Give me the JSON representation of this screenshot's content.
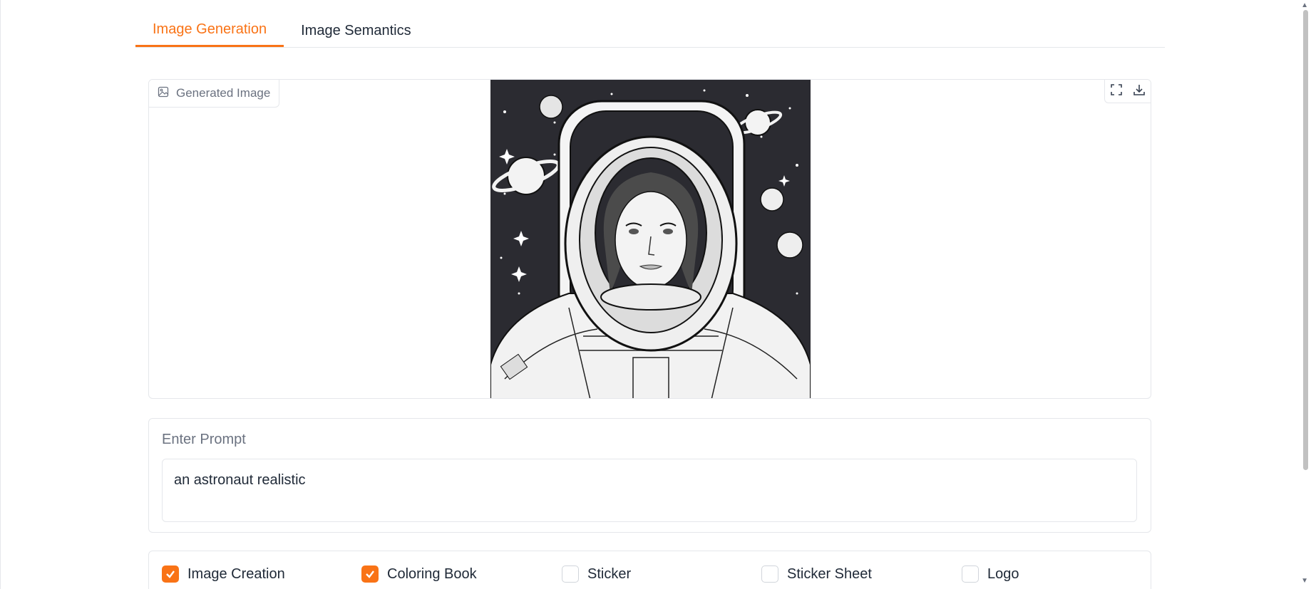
{
  "tabs": [
    {
      "label": "Image Generation",
      "active": true
    },
    {
      "label": "Image Semantics",
      "active": false
    }
  ],
  "image_panel": {
    "label": "Generated Image",
    "label_icon": "image-icon",
    "tools": [
      "fullscreen-icon",
      "download-icon"
    ],
    "image_description": "black and white line-art of a woman astronaut in space with planets and stars"
  },
  "prompt": {
    "label": "Enter Prompt",
    "value": "an astronaut realistic"
  },
  "options": [
    {
      "label": "Image Creation",
      "checked": true
    },
    {
      "label": "Coloring Book",
      "checked": true
    },
    {
      "label": "Sticker",
      "checked": false
    },
    {
      "label": "Sticker Sheet",
      "checked": false
    },
    {
      "label": "Logo",
      "checked": false
    }
  ],
  "colors": {
    "accent": "#f97316",
    "border": "#e5e7eb",
    "muted_text": "#6b7280"
  }
}
